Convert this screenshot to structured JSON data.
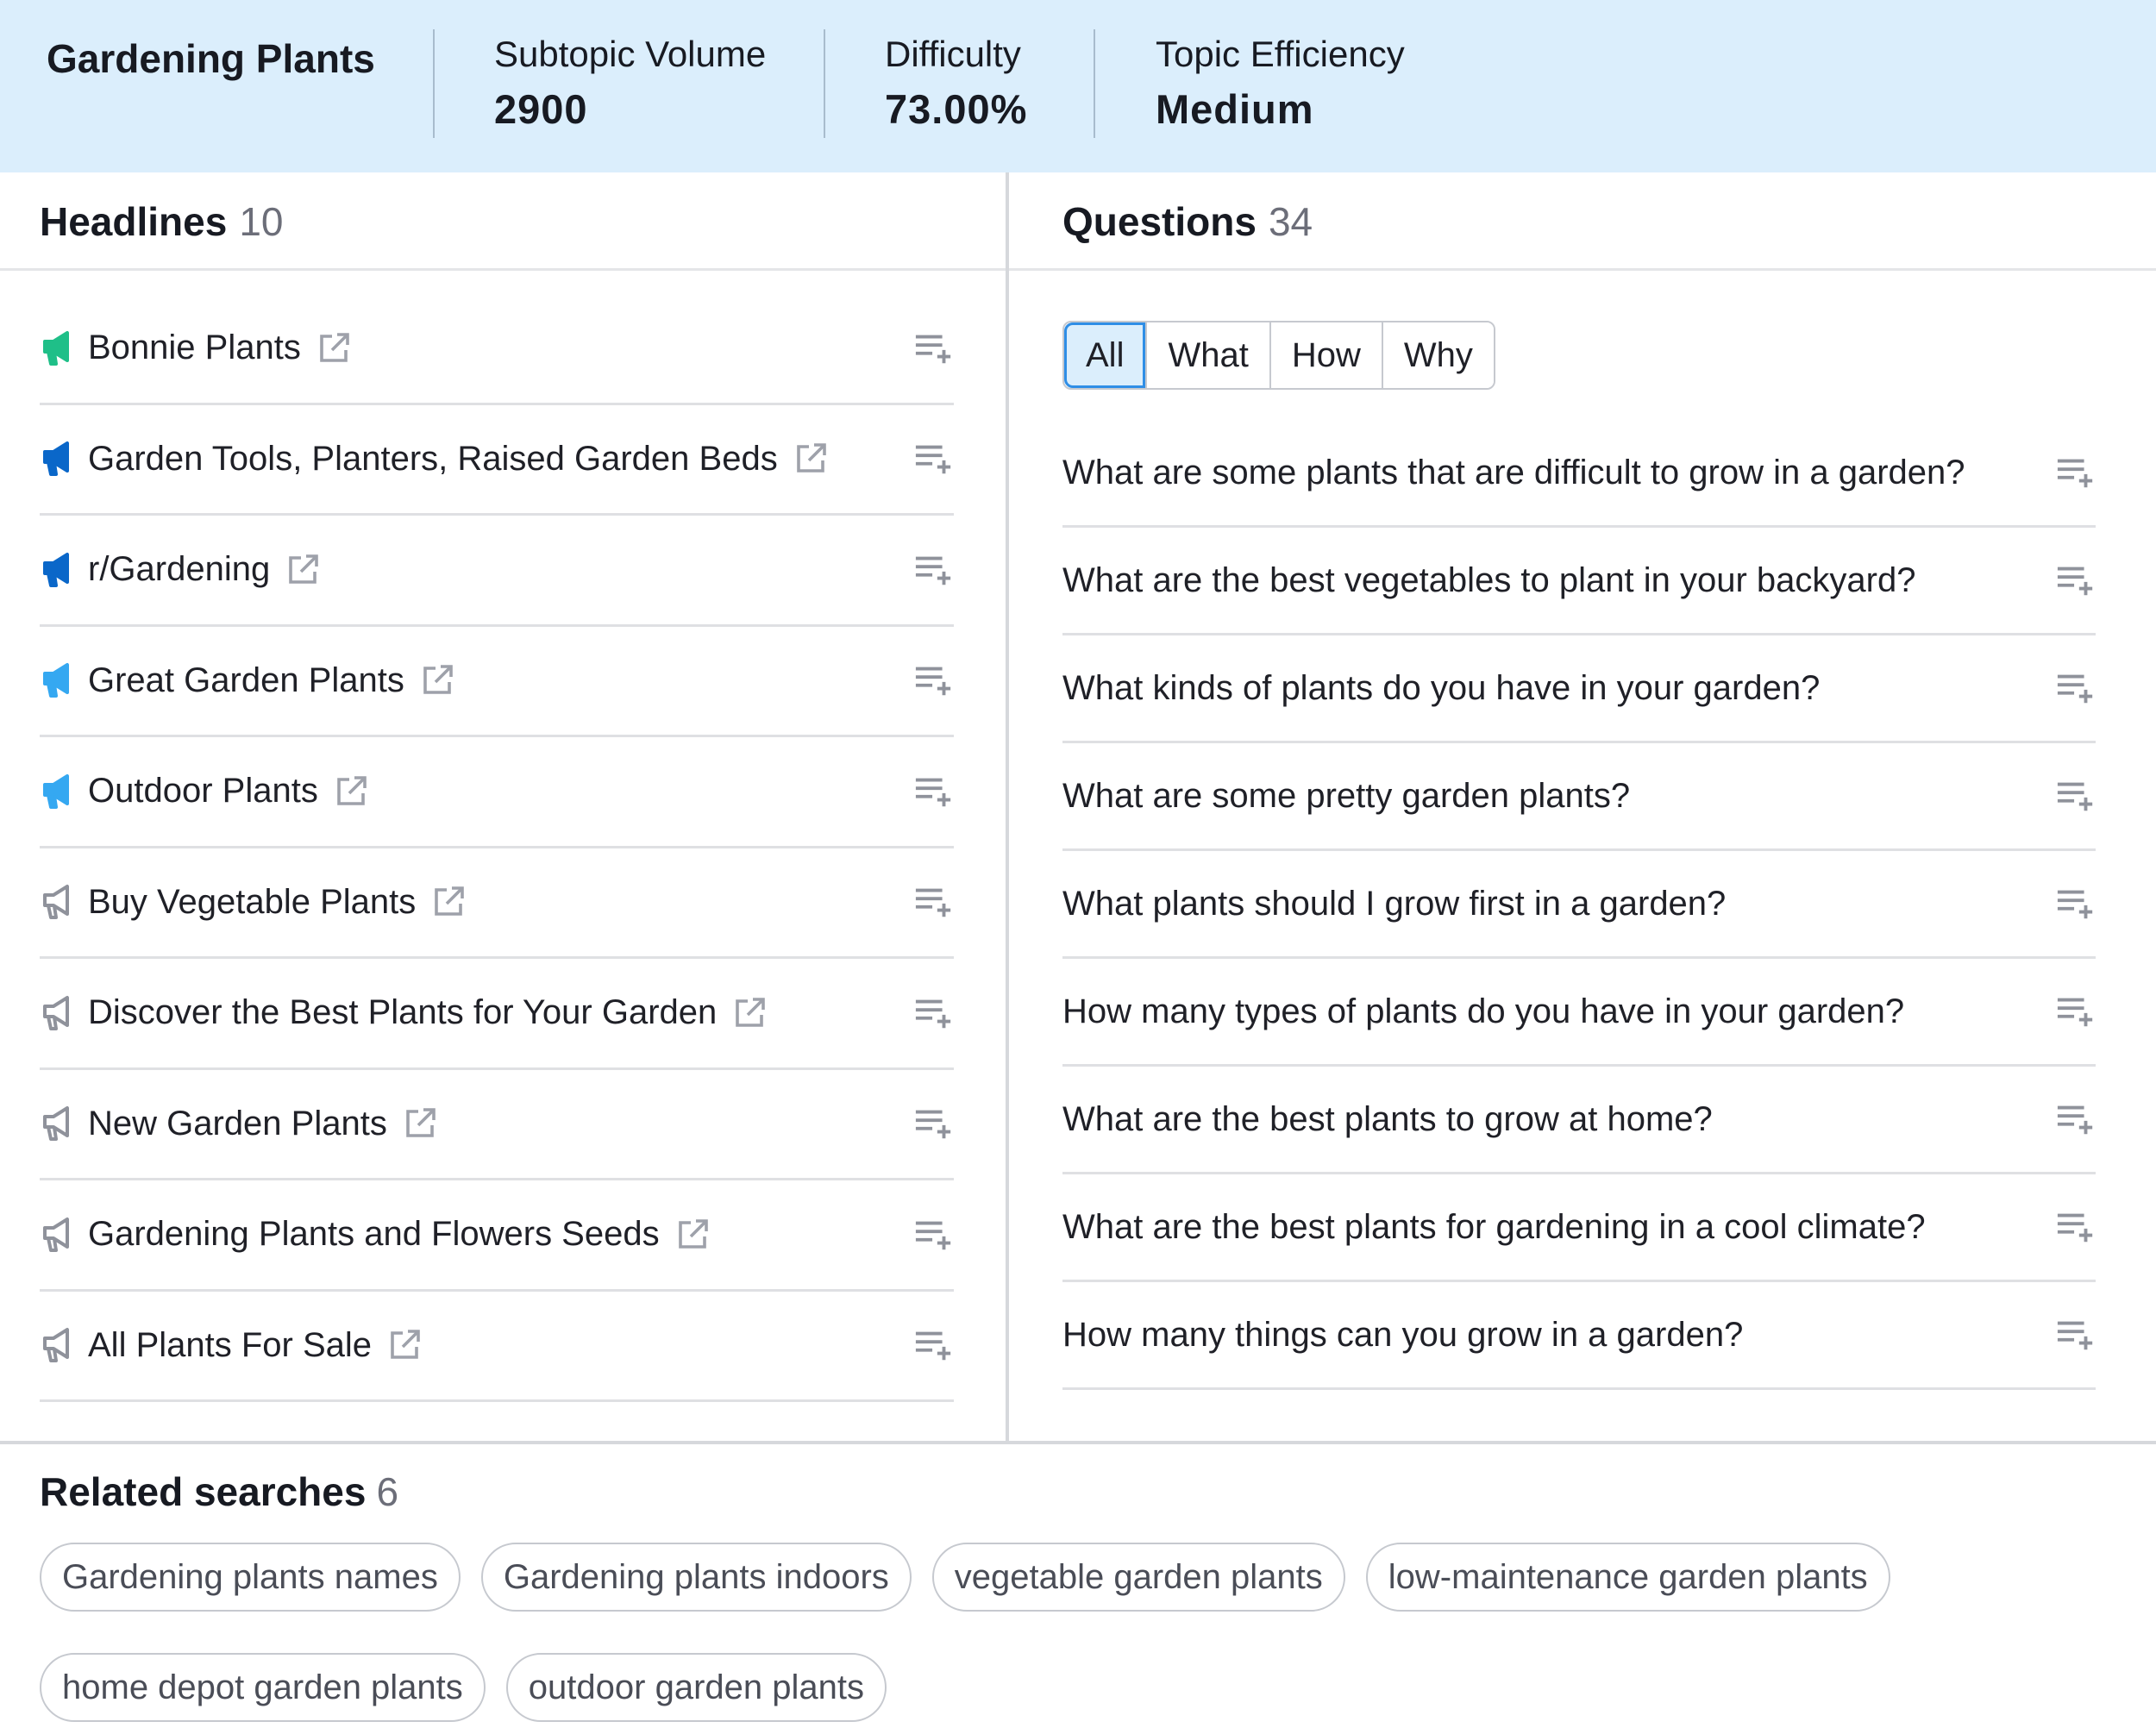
{
  "header": {
    "title": "Gardening Plants",
    "metrics": [
      {
        "label": "Subtopic Volume",
        "value": "2900"
      },
      {
        "label": "Difficulty",
        "value": "73.00%"
      },
      {
        "label": "Topic Efficiency",
        "value": "Medium"
      }
    ]
  },
  "headlines": {
    "title": "Headlines",
    "count": "10",
    "items": [
      {
        "label": "Bonnie Plants",
        "icon": "megaphone-icon",
        "color": "#1fbf88"
      },
      {
        "label": "Garden Tools, Planters, Raised Garden Beds",
        "icon": "megaphone-icon",
        "color": "#0a67c9"
      },
      {
        "label": "r/Gardening",
        "icon": "megaphone-icon",
        "color": "#0a67c9"
      },
      {
        "label": "Great Garden Plants",
        "icon": "megaphone-icon",
        "color": "#35a8f1"
      },
      {
        "label": "Outdoor Plants",
        "icon": "megaphone-icon",
        "color": "#35a8f1"
      },
      {
        "label": "Buy Vegetable Plants",
        "icon": "megaphone-outline-icon",
        "color": "#8f929b"
      },
      {
        "label": "Discover the Best Plants for Your Garden",
        "icon": "megaphone-outline-icon",
        "color": "#8f929b"
      },
      {
        "label": "New Garden Plants",
        "icon": "megaphone-outline-icon",
        "color": "#8f929b"
      },
      {
        "label": "Gardening Plants and Flowers Seeds",
        "icon": "megaphone-outline-icon",
        "color": "#8f929b"
      },
      {
        "label": "All Plants For Sale",
        "icon": "megaphone-outline-icon",
        "color": "#8f929b"
      }
    ]
  },
  "questions": {
    "title": "Questions",
    "count": "34",
    "tabs": [
      "All",
      "What",
      "How",
      "Why"
    ],
    "active_tab": "All",
    "items": [
      "What are some plants that are difficult to grow in a garden?",
      "What are the best vegetables to plant in your backyard?",
      "What kinds of plants do you have in your garden?",
      "What are some pretty garden plants?",
      "What plants should I grow first in a garden?",
      "How many types of plants do you have in your garden?",
      "What are the best plants to grow at home?",
      "What are the best plants for gardening in a cool climate?",
      "How many things can you grow in a garden?"
    ]
  },
  "related": {
    "title": "Related searches",
    "count": "6",
    "items": [
      "Gardening plants names",
      "Gardening plants indoors",
      "vegetable garden plants",
      "low-maintenance garden plants",
      "home depot garden plants",
      "outdoor garden plants"
    ]
  },
  "colors": {
    "header_bg": "#dbeefc",
    "active_tab_border": "#2f8ee6",
    "icon_gray": "#8f929b"
  }
}
